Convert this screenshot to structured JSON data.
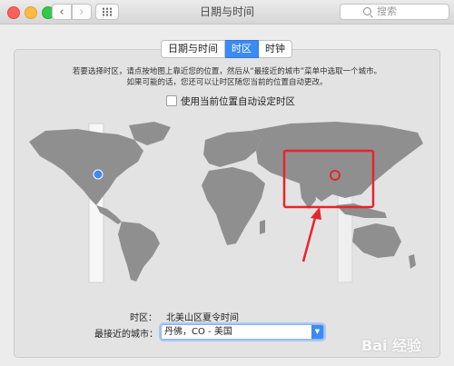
{
  "window": {
    "title": "日期与时间",
    "search_placeholder": "搜索",
    "back_arrow": "‹",
    "forward_arrow": "›"
  },
  "tabs": [
    {
      "label": "日期与时间",
      "active": false
    },
    {
      "label": "时区",
      "active": true
    },
    {
      "label": "时钟",
      "active": false
    }
  ],
  "instructions": {
    "line1": "若要选择时区，请点按地图上靠近您的位置，然后从“最接近的城市”菜单中选取一个城市。",
    "line2": "如果可能的话，您还可以让时区随您当前的位置自动更改。"
  },
  "auto_timezone": {
    "label": "使用当前位置自动设定时区",
    "checked": false
  },
  "timezone": {
    "label": "时区：",
    "value": "北美山区夏令时间"
  },
  "closest_city": {
    "label": "最接近的城市：",
    "value": "丹佛，CO - 美国"
  },
  "watermark": {
    "text": "Bai 经验"
  },
  "colors": {
    "accent": "#3c8bf5",
    "highlight": "#e8242b",
    "land": "#8f8f8f",
    "selected_band": "#f7f7f7"
  }
}
